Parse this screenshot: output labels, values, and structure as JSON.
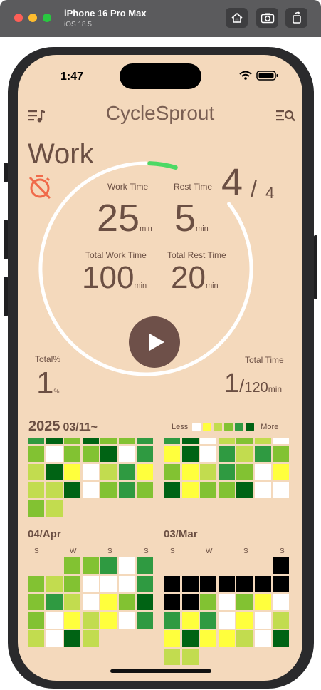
{
  "simulator": {
    "device_name": "iPhone 16 Pro Max",
    "os_version": "iOS 18.5"
  },
  "status_bar": {
    "time": "1:47"
  },
  "header": {
    "title": "CycleSprout",
    "left_icon": "music-list-icon",
    "right_icon": "list-search-icon"
  },
  "mode": {
    "label": "Work",
    "icon": "timer-off-icon"
  },
  "timer": {
    "work_time_label": "Work Time",
    "work_time_value": "25",
    "rest_time_label": "Rest Time",
    "rest_time_value": "5",
    "total_work_time_label": "Total Work Time",
    "total_work_time_value": "100",
    "total_rest_time_label": "Total Rest Time",
    "total_rest_time_value": "20",
    "unit": "min",
    "ring_progress_fraction": 0.04,
    "ring_track_color": "#ffffff",
    "ring_progress_color": "#4cd964"
  },
  "cycle": {
    "current": "4",
    "separator": "/",
    "total": "4"
  },
  "stats": {
    "total_percent_label": "Total%",
    "total_percent_value": "1",
    "percent_unit": "%",
    "total_time_label": "Total Time",
    "total_time_value": "1",
    "total_time_separator": "/",
    "total_time_goal": "120",
    "total_time_unit": "min"
  },
  "heatmap": {
    "year": "2025",
    "start_date": "03/11~",
    "legend_less": "Less",
    "legend_more": "More",
    "legend_colors": [
      "#ffffff",
      "#ffff3d",
      "#c2dc4f",
      "#82c232",
      "#2f9a41",
      "#006314"
    ],
    "months": [
      {
        "label": "04/Apr",
        "dow": [
          "S",
          "W",
          "S",
          "S"
        ]
      },
      {
        "label": "03/Mar",
        "dow": [
          "S",
          "W",
          "S",
          "S"
        ]
      }
    ]
  }
}
